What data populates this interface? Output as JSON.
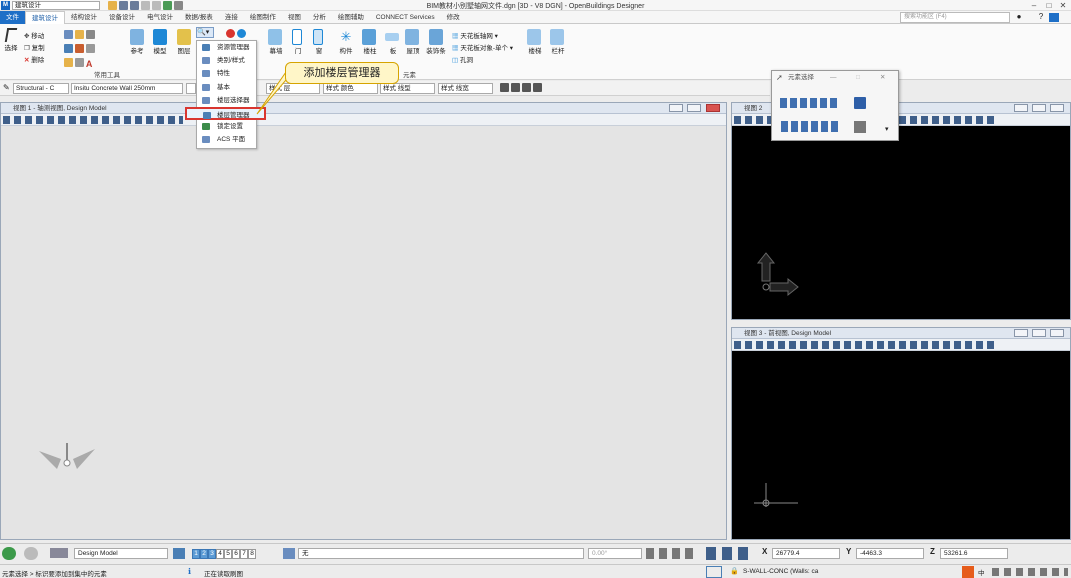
{
  "window": {
    "title": "BIM教材小别墅轴网文件.dgn [3D - V8 DGN] - OpenBuildings Designer",
    "workflow": "建筑设计"
  },
  "menu": {
    "tabs": [
      "文件",
      "建筑设计",
      "结构设计",
      "设备设计",
      "电气设计",
      "数据/报表",
      "连接",
      "绘图制作",
      "视图",
      "分析",
      "绘图辅助",
      "CONNECT Services",
      "修改"
    ],
    "search_placeholder": "搜索功能区 (F4)"
  },
  "ribbon": {
    "select_label": "选择",
    "move_label": "移动",
    "copy_label": "复制",
    "delete_label": "删除",
    "common_tools_label": "常用工具",
    "ref_label": "参考",
    "model_label": "模型",
    "layer_label": "图层",
    "curtain_label": "幕墙",
    "door_label": "门",
    "window_label": "窗",
    "member_label": "构件",
    "column_label": "楼柱",
    "slab_label": "板",
    "roof_label": "屋顶",
    "trim_label": "装饰条",
    "ceiling_grid_label": "天花板轴网",
    "ceiling_obj_label": "天花板对象-单个",
    "opening_label": "孔洞",
    "element_group_label": "元素",
    "stair_label": "楼梯",
    "railing_label": "栏杆"
  },
  "toolbar": {
    "discipline": "Structural - C",
    "wall_type": "Insitu Concrete Wall 250mm",
    "style_color": "样式 颜色",
    "style_linetype": "样式 线型",
    "style_lineweight": "样式 线宽",
    "style_layer": "样式 层"
  },
  "dropdown": {
    "items": [
      "资源管理器",
      "类别/样式",
      "特性",
      "基本",
      "楼层选择器",
      "楼层管理器",
      "锁定设置",
      "ACS 平面"
    ]
  },
  "callout": {
    "text": "添加楼层管理器"
  },
  "views": {
    "view1_title": "视图 1 - 轴测视图, Design Model",
    "view2_title": "视图 2",
    "view3_title": "视图 3 - 前视图, Design Model"
  },
  "selection_panel": {
    "title": "元素选择"
  },
  "navbar": {
    "model": "Design Model",
    "pages": [
      "1",
      "2",
      "3",
      "4",
      "5",
      "6",
      "7",
      "8"
    ],
    "level_value": "无",
    "angle": "0.00°",
    "x_label": "X",
    "x_value": "26779.4",
    "y_label": "Y",
    "y_value": "-4463.3",
    "z_label": "Z",
    "z_value": "53261.6"
  },
  "statusbar": {
    "left_text": "元素选择 > 标识要添加到集中的元素",
    "mid_text": "正在读取刷图",
    "right_text": "S-WALL-CONC (Walls: ca",
    "ime": "中"
  },
  "colors": {
    "accent": "#1e6fc7",
    "highlight_border": "#d9352f",
    "callout_bg": "#fff6c8"
  }
}
